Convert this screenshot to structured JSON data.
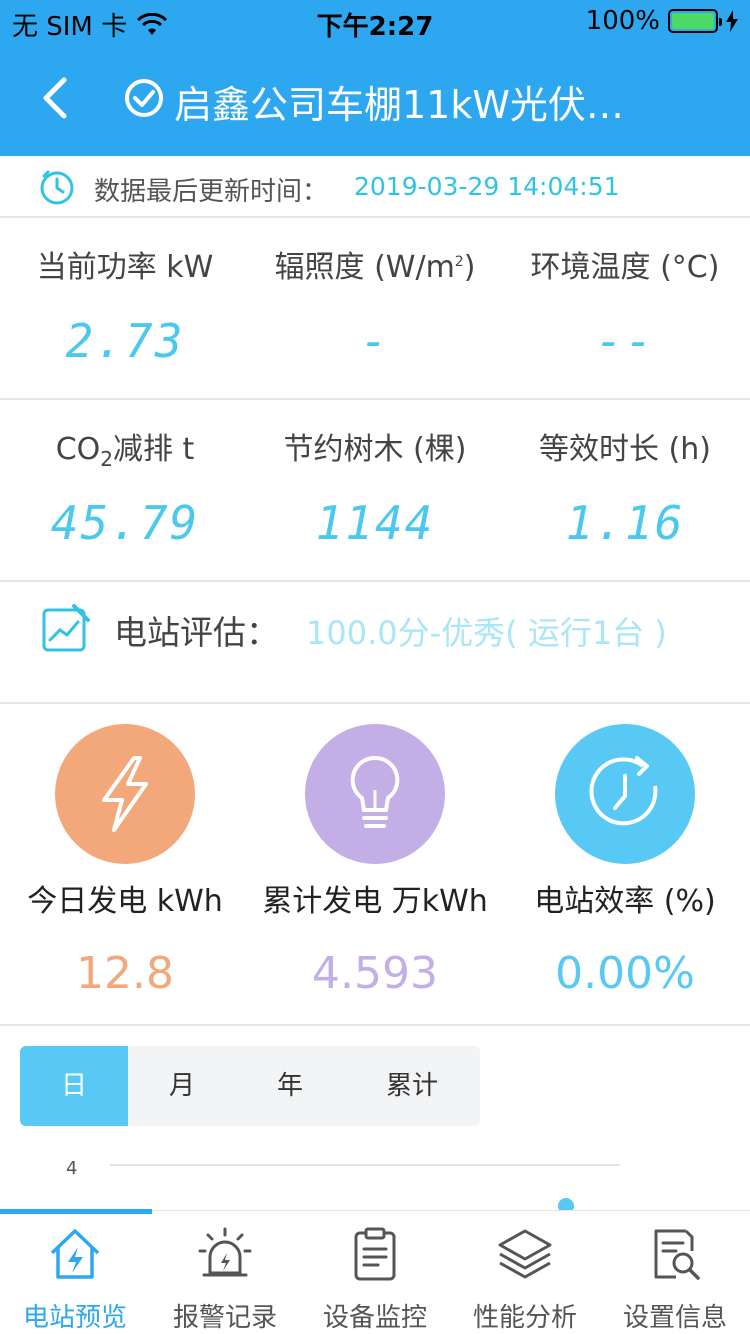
{
  "status": {
    "carrier": "无 SIM 卡",
    "time": "下午2:27",
    "battery": "100%"
  },
  "nav": {
    "title": "启鑫公司车棚11kW光伏…"
  },
  "update": {
    "label": "数据最后更新时间：",
    "value": "2019-03-29 14:04:51"
  },
  "metrics_top": [
    {
      "label": "当前功率 kW",
      "value": "2.73"
    },
    {
      "label_prefix": "辐照度 (W/m",
      "label_sup": "2",
      "label_suffix": ")",
      "value": "-"
    },
    {
      "label": "环境温度 (°C)",
      "value": "--"
    }
  ],
  "metrics_bottom": [
    {
      "label_prefix": "CO",
      "label_sub": "2",
      "label_suffix": "减排 t",
      "value": "45.79"
    },
    {
      "label": "节约树木 (棵)",
      "value": "1144"
    },
    {
      "label": "等效时长 (h)",
      "value": "1.16"
    }
  ],
  "evaluation": {
    "label": "电站评估：",
    "value": "100.0分-优秀( 运行1台 )"
  },
  "summary": [
    {
      "icon": "lightning-icon",
      "color": "#f2a87b",
      "label": "今日发电 kWh",
      "value": "12.8"
    },
    {
      "icon": "lightbulb-icon",
      "color": "#c3aee6",
      "label": "累计发电 万kWh",
      "value": "4.593"
    },
    {
      "icon": "timer-icon",
      "color": "#58c8f4",
      "label": "电站效率 (%)",
      "value": "0.00%"
    }
  ],
  "period_tabs": {
    "day": "日",
    "month": "月",
    "year": "年",
    "total": "累计",
    "selected": "日"
  },
  "chart_data": {
    "type": "line",
    "yticks": [
      "4"
    ],
    "points": []
  },
  "tabbar": {
    "items": [
      "电站预览",
      "报警记录",
      "设备监控",
      "性能分析",
      "设置信息"
    ],
    "active": "电站预览",
    "accent": "#2ea7f1"
  }
}
